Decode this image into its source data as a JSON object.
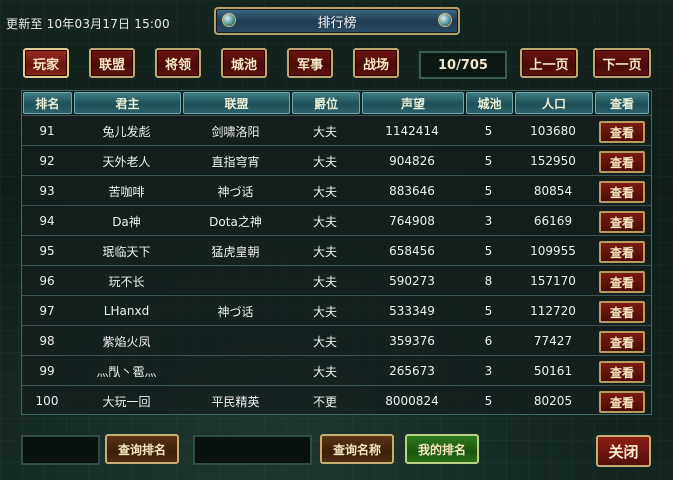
{
  "update_label": "更新至 10年03月17日 15:00",
  "title": "排行榜",
  "tabs": [
    {
      "label": "玩家",
      "active": true
    },
    {
      "label": "联盟",
      "active": false
    },
    {
      "label": "将领",
      "active": false
    },
    {
      "label": "城池",
      "active": false
    },
    {
      "label": "军事",
      "active": false
    },
    {
      "label": "战场",
      "active": false
    }
  ],
  "pagination": {
    "page_display": "10/705",
    "prev_label": "上一页",
    "next_label": "下一页"
  },
  "table": {
    "headers": [
      "排名",
      "君主",
      "联盟",
      "爵位",
      "声望",
      "城池",
      "人口",
      "查看"
    ],
    "view_label": "查看",
    "rows": [
      {
        "rank": "91",
        "lord": "兔儿发彪",
        "alliance": "剑啸洛阳",
        "title": "大夫",
        "prestige": "1142414",
        "cities": "5",
        "population": "103680"
      },
      {
        "rank": "92",
        "lord": "天外老人",
        "alliance": "直指穹宵",
        "title": "大夫",
        "prestige": "904826",
        "cities": "5",
        "population": "152950"
      },
      {
        "rank": "93",
        "lord": "苦咖啡",
        "alliance": "神づ话",
        "title": "大夫",
        "prestige": "883646",
        "cities": "5",
        "population": "80854"
      },
      {
        "rank": "94",
        "lord": "Da神",
        "alliance": "Dota之神",
        "title": "大夫",
        "prestige": "764908",
        "cities": "3",
        "population": "66169"
      },
      {
        "rank": "95",
        "lord": "珉临天下",
        "alliance": "猛虎皇朝",
        "title": "大夫",
        "prestige": "658456",
        "cities": "5",
        "population": "109955"
      },
      {
        "rank": "96",
        "lord": "玩不长",
        "alliance": "",
        "title": "大夫",
        "prestige": "590273",
        "cities": "8",
        "population": "157170"
      },
      {
        "rank": "97",
        "lord": "LHanxd",
        "alliance": "神づ话",
        "title": "大夫",
        "prestige": "533349",
        "cities": "5",
        "population": "112720"
      },
      {
        "rank": "98",
        "lord": "紫焰火凤",
        "alliance": "",
        "title": "大夫",
        "prestige": "359376",
        "cities": "6",
        "population": "77427"
      },
      {
        "rank": "99",
        "lord": "灬閄丶雹灬",
        "alliance": "",
        "title": "大夫",
        "prestige": "265673",
        "cities": "3",
        "population": "50161"
      },
      {
        "rank": "100",
        "lord": "大玩一回",
        "alliance": "平民精英",
        "title": "不更",
        "prestige": "8000824",
        "cities": "5",
        "population": "80205"
      }
    ]
  },
  "bottom": {
    "search_rank_label": "查询排名",
    "search_name_label": "查询名称",
    "my_rank_label": "我的排名",
    "close_label": "关闭",
    "search_rank_value": "",
    "search_name_value": ""
  }
}
